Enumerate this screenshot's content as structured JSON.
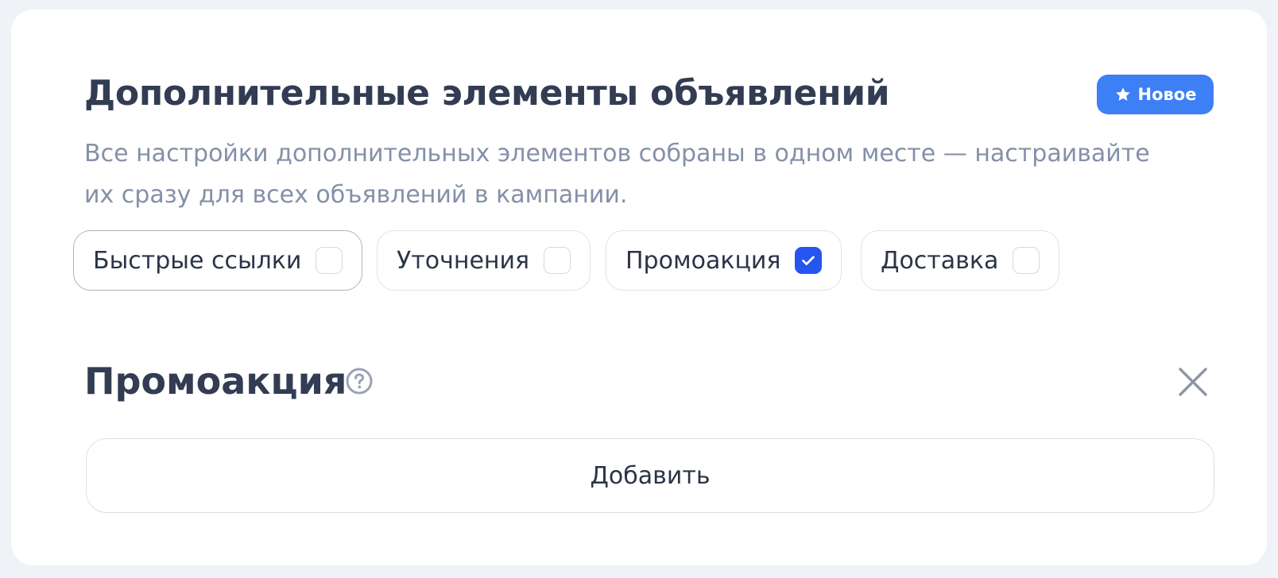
{
  "header": {
    "title": "Дополнительные элементы объявлений",
    "badge_label": "Новое",
    "badge_icon": "star-icon",
    "description_line1": "Все настройки дополнительных элементов собраны в одном месте — настраивайте",
    "description_line2": "их сразу для всех объявлений в кампании."
  },
  "chips": [
    {
      "label": "Быстрые ссылки",
      "checked": false
    },
    {
      "label": "Уточнения",
      "checked": false
    },
    {
      "label": "Промоакция",
      "checked": true
    },
    {
      "label": "Доставка",
      "checked": false
    }
  ],
  "section": {
    "title": "Промоакция",
    "help_icon": "help-circle-icon",
    "close_icon": "close-icon",
    "add_label": "Добавить"
  },
  "colors": {
    "accent": "#2655f0",
    "badge": "#3d7ff5",
    "text": "#323c53",
    "muted": "#8490a8",
    "background": "#eff2f7"
  }
}
